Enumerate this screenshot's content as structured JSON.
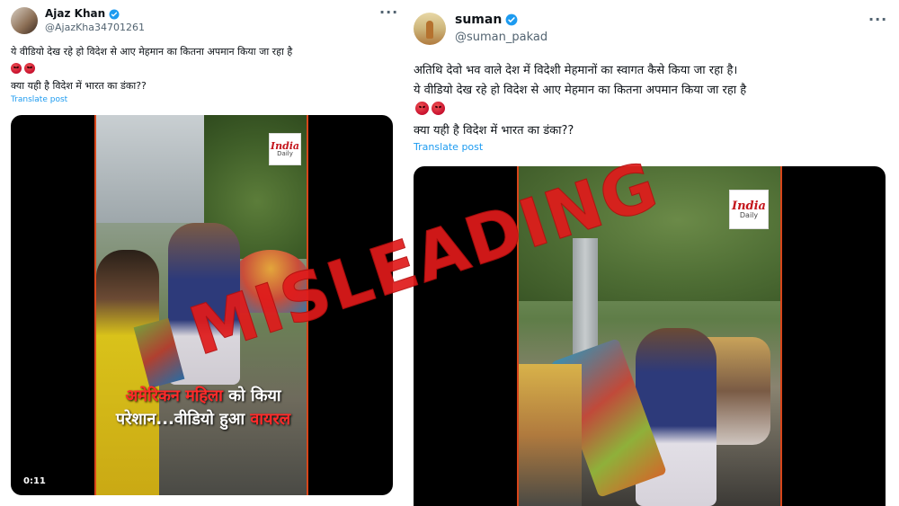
{
  "left_post": {
    "name": "Ajaz Khan",
    "handle": "@AjazKha34701261",
    "more": "···",
    "text_line1": "ये वीडियो देख रहे हो विदेश से आए मेहमान का कितना अपमान किया जा रहा है",
    "text_line2": "क्या यही है विदेश में भारत का डंका??",
    "translate": "Translate post",
    "video": {
      "logo_line1": "India",
      "logo_line2": "Daily",
      "caption_line1_red": "अमेरिकन महिला",
      "caption_line1_white": " को किया",
      "caption_line2_white": "परेशान...वीडियो हुआ ",
      "caption_line2_red": "वायरल",
      "duration": "0:11"
    }
  },
  "right_post": {
    "name": "suman",
    "handle": "@suman_pakad",
    "more": "···",
    "text_line1": "अतिथि देवो भव वाले देश में विदेशी मेहमानों का स्वागत कैसे किया जा रहा है।",
    "text_line2": "ये वीडियो देख रहे हो विदेश से आए मेहमान का कितना अपमान किया जा रहा है",
    "text_line3": "क्या यही है विदेश में भारत का डंका??",
    "translate": "Translate post",
    "video": {
      "logo_line1": "India",
      "logo_line2": "Daily"
    }
  },
  "stamp": "MISLEADING",
  "colors": {
    "verified": "#1d9bf0",
    "stamp": "#e01b1b",
    "link": "#1d9bf0"
  }
}
